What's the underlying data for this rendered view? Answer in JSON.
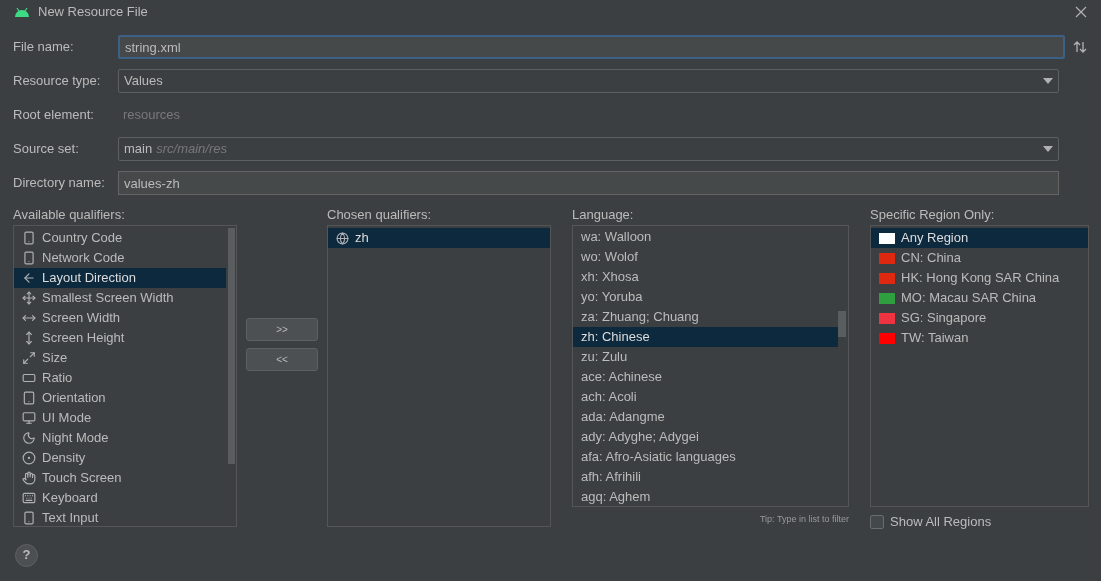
{
  "window": {
    "title": "New Resource File"
  },
  "form": [
    {
      "label": "File name:",
      "kind": "text",
      "value": "string.xml",
      "focused": true
    },
    {
      "label": "Resource type:",
      "kind": "dropdown",
      "value": "Values"
    },
    {
      "label": "Root element:",
      "kind": "static",
      "value": "resources"
    },
    {
      "label": "Source set:",
      "kind": "dropdown",
      "value": "main",
      "hint": "src/main/res"
    },
    {
      "label": "Directory name:",
      "kind": "text",
      "value": "values-zh",
      "focused": false
    }
  ],
  "available_qualifiers": {
    "label": "Available qualifiers:",
    "items": [
      {
        "label": "Country Code",
        "selected": false
      },
      {
        "label": "Network Code",
        "selected": false
      },
      {
        "label": "Layout Direction",
        "selected": true
      },
      {
        "label": "Smallest Screen Width",
        "selected": false
      },
      {
        "label": "Screen Width",
        "selected": false
      },
      {
        "label": "Screen Height",
        "selected": false
      },
      {
        "label": "Size",
        "selected": false
      },
      {
        "label": "Ratio",
        "selected": false
      },
      {
        "label": "Orientation",
        "selected": false
      },
      {
        "label": "UI Mode",
        "selected": false
      },
      {
        "label": "Night Mode",
        "selected": false
      },
      {
        "label": "Density",
        "selected": false
      },
      {
        "label": "Touch Screen",
        "selected": false
      },
      {
        "label": "Keyboard",
        "selected": false
      },
      {
        "label": "Text Input",
        "selected": false
      }
    ]
  },
  "move_buttons": [
    ">>",
    "<<"
  ],
  "chosen_qualifiers": {
    "label": "Chosen qualifiers:",
    "items": [
      {
        "label": "zh",
        "selected": true
      }
    ]
  },
  "language": {
    "label": "Language:",
    "items": [
      {
        "label": "wa: Walloon",
        "selected": false
      },
      {
        "label": "wo: Wolof",
        "selected": false
      },
      {
        "label": "xh: Xhosa",
        "selected": false
      },
      {
        "label": "yo: Yoruba",
        "selected": false
      },
      {
        "label": "za: Zhuang; Chuang",
        "selected": false
      },
      {
        "label": "zh: Chinese",
        "selected": true
      },
      {
        "label": "zu: Zulu",
        "selected": false
      },
      {
        "label": "ace: Achinese",
        "selected": false
      },
      {
        "label": "ach: Acoli",
        "selected": false
      },
      {
        "label": "ada: Adangme",
        "selected": false
      },
      {
        "label": "ady: Adyghe; Adygei",
        "selected": false
      },
      {
        "label": "afa: Afro-Asiatic languages",
        "selected": false
      },
      {
        "label": "afh: Afrihili",
        "selected": false
      },
      {
        "label": "agq: Aghem",
        "selected": false
      }
    ],
    "tip": "Tip: Type in list to filter"
  },
  "region": {
    "label": "Specific Region Only:",
    "items": [
      {
        "label": "Any Region",
        "selected": true,
        "color": "#ffffff"
      },
      {
        "label": "CN: China",
        "selected": false,
        "color": "#de2910"
      },
      {
        "label": "HK: Hong Kong SAR China",
        "selected": false,
        "color": "#de2910"
      },
      {
        "label": "MO: Macau SAR China",
        "selected": false,
        "color": "#2e9e3f"
      },
      {
        "label": "SG: Singapore",
        "selected": false,
        "color": "#ef3340"
      },
      {
        "label": "TW: Taiwan",
        "selected": false,
        "color": "#fe0000"
      }
    ],
    "show_all": {
      "label": "Show All Regions",
      "checked": false
    }
  },
  "help": "?"
}
